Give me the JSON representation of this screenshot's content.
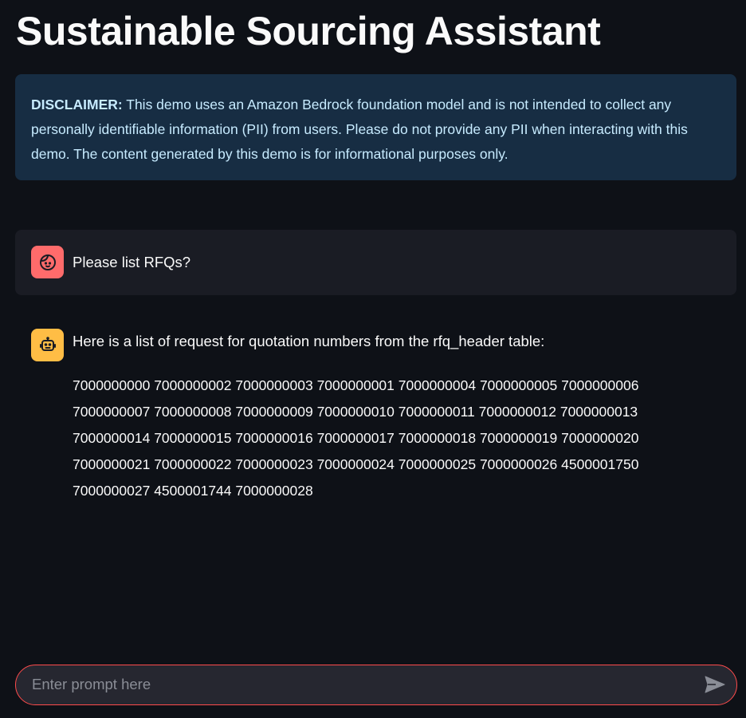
{
  "app": {
    "title": "Sustainable Sourcing Assistant"
  },
  "disclaimer": {
    "label": "DISCLAIMER:",
    "text": " This demo uses an Amazon Bedrock foundation model and is not intended to collect any personally identifiable information (PII) from users. Please do not provide any PII when interacting with this demo. The content generated by this demo is for informational purposes only."
  },
  "messages": {
    "user": {
      "avatar_icon": "user-face-icon",
      "text": "Please list RFQs?"
    },
    "assistant": {
      "avatar_icon": "robot-icon",
      "intro": "Here is a list of request for quotation numbers from the rfq_header table:",
      "rfq_lines": [
        "7000000000 7000000002 7000000003 7000000001 7000000004 7000000005 7000000006",
        "7000000007 7000000008 7000000009 7000000010 7000000011 7000000012 7000000013",
        "7000000014 7000000015 7000000016 7000000017 7000000018 7000000019 7000000020",
        "7000000021 7000000022 7000000023 7000000024 7000000025 7000000026 4500001750",
        "7000000027 4500001744 7000000028"
      ]
    }
  },
  "chat_input": {
    "placeholder": "Enter prompt here",
    "value": "",
    "send_icon": "send-icon"
  },
  "colors": {
    "background": "#0e1117",
    "disclaimer_bg": "#172d43",
    "disclaimer_text": "#c7ebff",
    "user_message_bg": "#1a1c24",
    "user_avatar": "#ff6b6b",
    "bot_avatar": "#ffbd45",
    "input_border": "#ff4b4b"
  }
}
